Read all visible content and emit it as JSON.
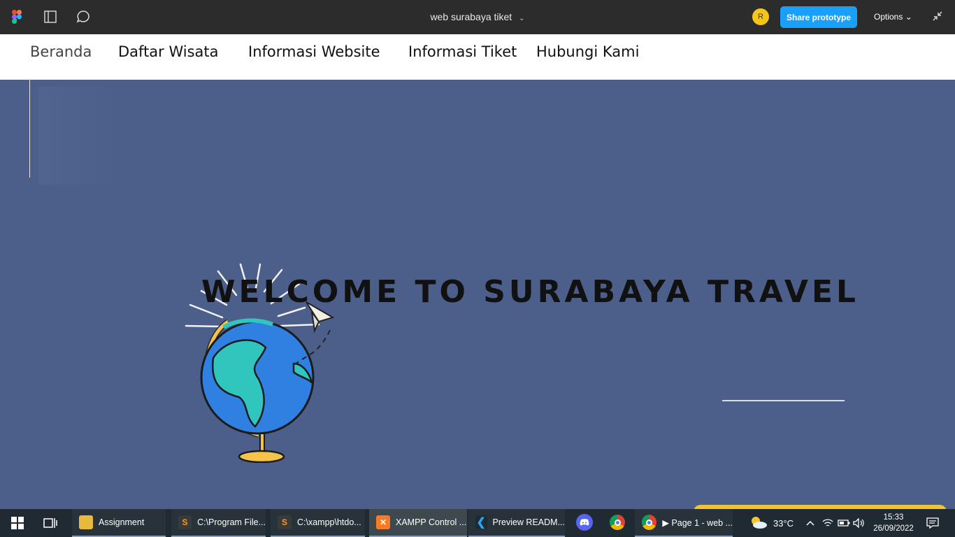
{
  "figma": {
    "title": "web surabaya tiket",
    "title_chevron": "⌄",
    "avatar_initial": "R",
    "share_label": "Share prototype",
    "options_label": "Options ⌄",
    "icons": [
      "figma-logo-icon",
      "panel-toggle-icon",
      "comment-icon",
      "collapse-icon"
    ]
  },
  "nav": {
    "items": [
      {
        "label": "Beranda"
      },
      {
        "label": "Daftar Wisata"
      },
      {
        "label": "Informasi Website"
      },
      {
        "label": "Informasi Tiket"
      },
      {
        "label": "Hubungi Kami"
      }
    ]
  },
  "hero": {
    "title": "WELCOME TO SURABAYA TRAVEL",
    "illustration": "globe-with-paper-plane-icon"
  },
  "taskbar": {
    "apps": [
      {
        "label": "Assignment",
        "icon": "folder-icon"
      },
      {
        "label": "C:\\Program File...",
        "icon": "sublime-icon"
      },
      {
        "label": "C:\\xampp\\htdo...",
        "icon": "sublime-icon"
      },
      {
        "label": "XAMPP Control ...",
        "icon": "xampp-icon"
      },
      {
        "label": "Preview READM...",
        "icon": "vscode-icon"
      },
      {
        "label": "",
        "icon": "discord-icon"
      },
      {
        "label": "",
        "icon": "chrome-icon"
      },
      {
        "label": "▶ Page 1 - web ...",
        "icon": "chrome-icon"
      }
    ],
    "weather": "33°C",
    "time": "15:33",
    "date": "26/09/2022"
  },
  "colors": {
    "hero_bg": "#4c5f8b",
    "figma_bar": "#2c2c2c",
    "share_button": "#18a0fb",
    "taskbar": "#1f2a33"
  }
}
